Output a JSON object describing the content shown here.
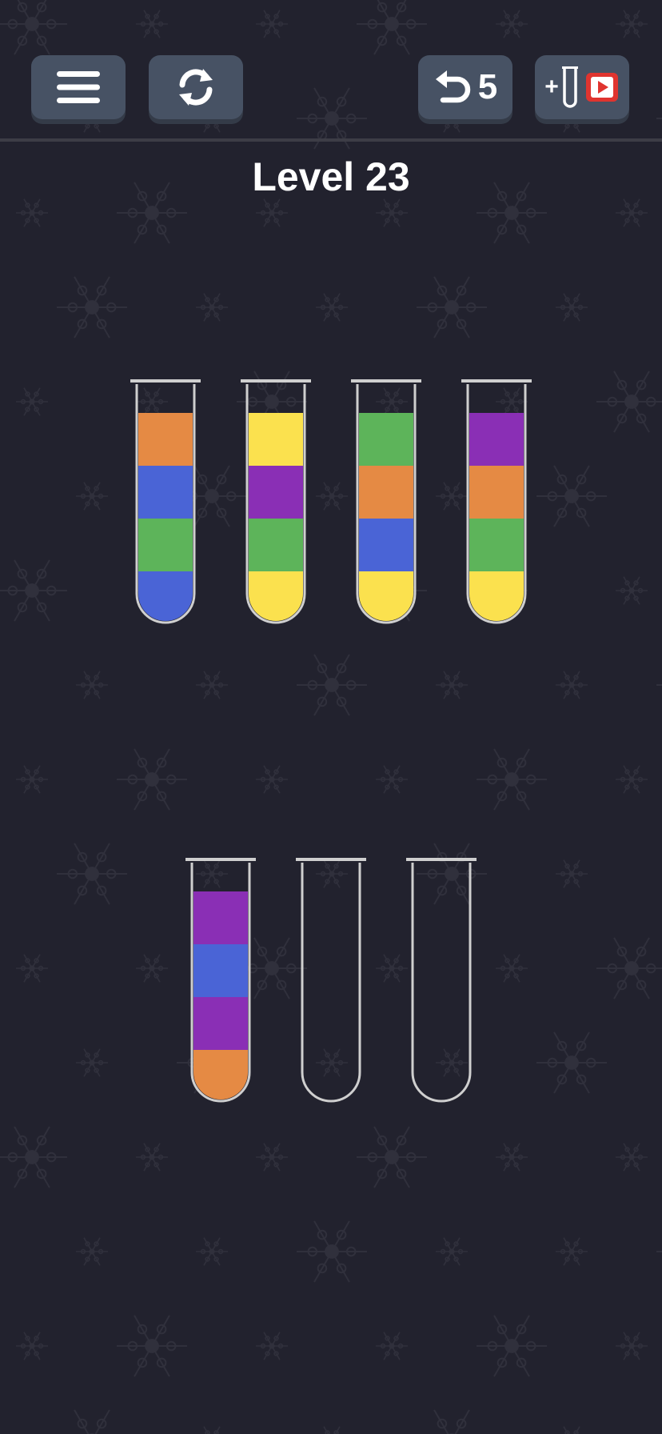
{
  "header": {
    "level_label": "Level 23",
    "undo_count": "5",
    "add_tube_plus": "+"
  },
  "icons": {
    "menu": "hamburger-menu-icon",
    "restart": "restart-arrows-icon",
    "undo": "undo-arrow-icon",
    "add_tube": "test-tube-icon",
    "video": "video-play-icon"
  },
  "colors": {
    "background": "#22222e",
    "button": "#475264",
    "orange": "#e58a44",
    "blue": "#4a64d6",
    "green": "#5db45a",
    "yellow": "#fbe14e",
    "purple": "#8a2fb5",
    "tube_outline": "#cfcfcf"
  },
  "game": {
    "capacity": 4,
    "tubes_top_to_bottom_layers": [
      [
        "orange",
        "blue",
        "green",
        "blue"
      ],
      [
        "yellow",
        "purple",
        "green",
        "yellow"
      ],
      [
        "green",
        "orange",
        "blue",
        "yellow"
      ],
      [
        "purple",
        "orange",
        "green",
        "yellow"
      ],
      [
        "purple",
        "blue",
        "purple",
        "orange"
      ],
      [],
      []
    ]
  }
}
